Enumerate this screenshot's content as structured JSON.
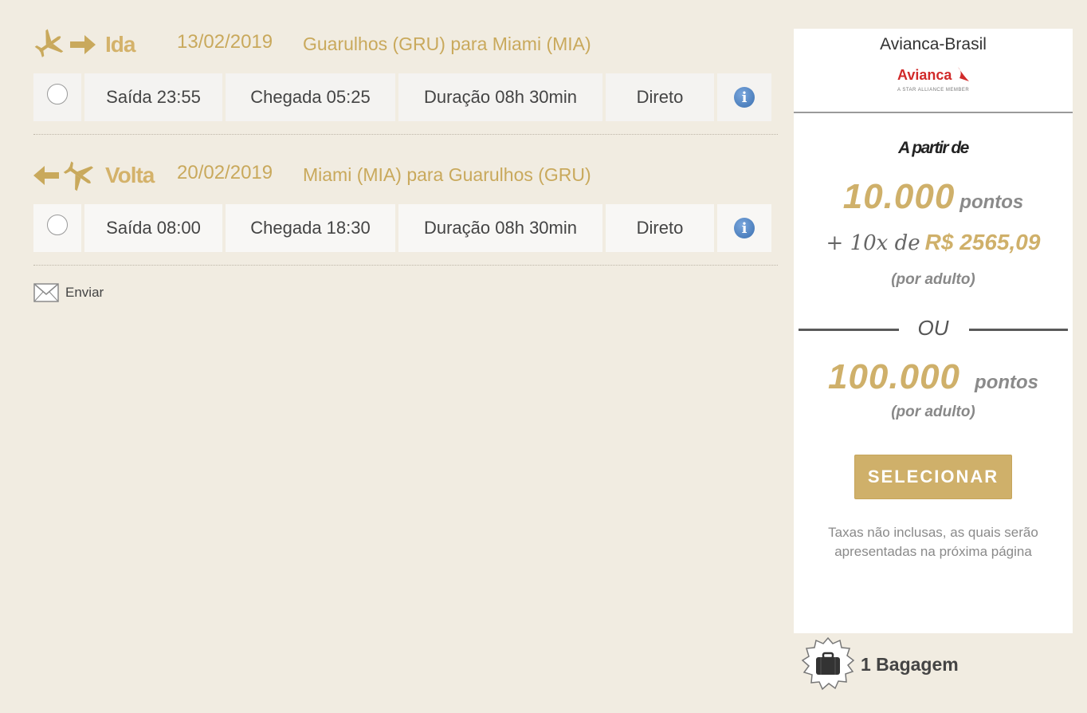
{
  "outbound": {
    "label": "Ida",
    "date": "13/02/2019",
    "route": "Guarulhos (GRU) para Miami (MIA)",
    "departure": "Saída 23:55",
    "arrival": "Chegada 05:25",
    "duration": "Duração 08h 30min",
    "stops": "Direto"
  },
  "return": {
    "label": "Volta",
    "date": "20/02/2019",
    "route": "Miami (MIA) para Guarulhos (GRU)",
    "departure": "Saída 08:00",
    "arrival": "Chegada 18:30",
    "duration": "Duração 08h 30min",
    "stops": "Direto"
  },
  "send_label": "Enviar",
  "offer": {
    "airline": "Avianca-Brasil",
    "logo_text": "Avianca",
    "logo_tagline": "A STAR ALLIANCE MEMBER",
    "from_label": "A partir de",
    "points_amount": "10.000",
    "points_unit": "pontos",
    "installments_prefix": "+ 10x de",
    "installments_amount": "R$ 2565,09",
    "per_adult": "(por adulto)",
    "or_label": "OU",
    "points_only_amount": "100.000",
    "points_only_unit": "pontos",
    "per_adult_2": "(por adulto)",
    "select_button": "SELECIONAR",
    "taxes_note_1": "Taxas não inclusas, as quais serão",
    "taxes_note_2": "apresentadas na próxima página"
  },
  "baggage": "1 Bagagem",
  "colors": {
    "gold": "#cfb06a",
    "background": "#f1ece1",
    "info_blue": "#3a6fb0",
    "avianca_red": "#d12a2a"
  }
}
